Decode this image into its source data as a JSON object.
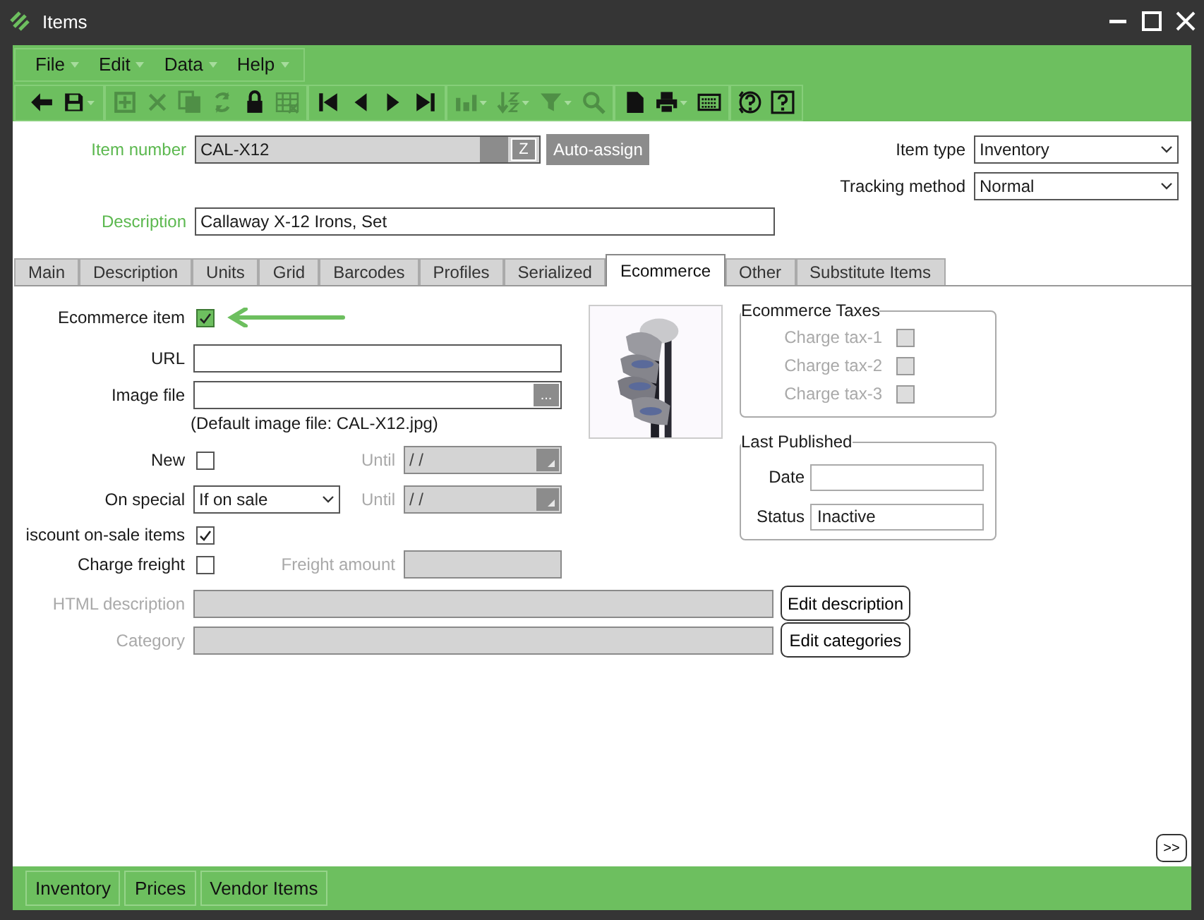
{
  "window": {
    "title": "Items"
  },
  "menu": [
    {
      "label": "File"
    },
    {
      "label": "Edit"
    },
    {
      "label": "Data"
    },
    {
      "label": "Help"
    }
  ],
  "toolbar": {
    "groups": [
      {
        "buttons": [
          {
            "kind": "back",
            "disabled": false,
            "dropdown": false
          },
          {
            "kind": "save",
            "disabled": false,
            "dropdown": true
          }
        ]
      },
      {
        "buttons": [
          {
            "kind": "add",
            "disabled": true,
            "dropdown": false
          },
          {
            "kind": "delete",
            "disabled": true,
            "dropdown": false
          },
          {
            "kind": "copy",
            "disabled": true,
            "dropdown": false
          },
          {
            "kind": "refresh",
            "disabled": true,
            "dropdown": false
          },
          {
            "kind": "lock",
            "disabled": false,
            "dropdown": false
          },
          {
            "kind": "grid",
            "disabled": true,
            "dropdown": false
          }
        ]
      },
      {
        "buttons": [
          {
            "kind": "first",
            "disabled": false,
            "dropdown": false
          },
          {
            "kind": "previous",
            "disabled": false,
            "dropdown": false
          },
          {
            "kind": "next",
            "disabled": false,
            "dropdown": false
          },
          {
            "kind": "last",
            "disabled": false,
            "dropdown": false
          }
        ]
      },
      {
        "buttons": [
          {
            "kind": "chart",
            "disabled": true,
            "dropdown": true
          },
          {
            "kind": "sort",
            "disabled": true,
            "dropdown": true
          },
          {
            "kind": "filter",
            "disabled": true,
            "dropdown": true
          },
          {
            "kind": "search",
            "disabled": true,
            "dropdown": false
          }
        ]
      },
      {
        "buttons": [
          {
            "kind": "document",
            "disabled": false,
            "dropdown": false
          },
          {
            "kind": "print",
            "disabled": false,
            "dropdown": true
          },
          {
            "kind": "keyboard",
            "disabled": false,
            "dropdown": false
          }
        ]
      },
      {
        "buttons": [
          {
            "kind": "help-circle",
            "disabled": false,
            "dropdown": false
          },
          {
            "kind": "help-box",
            "disabled": false,
            "dropdown": false
          }
        ]
      }
    ]
  },
  "header": {
    "item_number": {
      "label": "Item number",
      "value": "CAL-X12",
      "zoom_button": "Z"
    },
    "auto_assign": "Auto-assign",
    "description": {
      "label": "Description",
      "value": "Callaway X-12 Irons, Set"
    },
    "item_type": {
      "label": "Item type",
      "value": "Inventory"
    },
    "tracking_method": {
      "label": "Tracking method",
      "value": "Normal"
    }
  },
  "tabs": [
    {
      "label": "Main",
      "selected": false
    },
    {
      "label": "Description",
      "selected": false
    },
    {
      "label": "Units",
      "selected": false
    },
    {
      "label": "Grid",
      "selected": false
    },
    {
      "label": "Barcodes",
      "selected": false
    },
    {
      "label": "Profiles",
      "selected": false
    },
    {
      "label": "Serialized",
      "selected": false
    },
    {
      "label": "Ecommerce",
      "selected": true
    },
    {
      "label": "Other",
      "selected": false
    },
    {
      "label": "Substitute Items",
      "selected": false
    }
  ],
  "ecommerce": {
    "ecommerce_item": {
      "label": "Ecommerce item",
      "checked": true,
      "focused": true
    },
    "url": {
      "label": "URL"
    },
    "image_file": {
      "label": "Image file",
      "browse_button": "...",
      "note": "(Default image file: CAL-X12.jpg)"
    },
    "new": {
      "label": "New",
      "checked": false,
      "until": {
        "label": "Until",
        "value": "/ /",
        "disabled": true
      }
    },
    "on_special": {
      "label": "On special",
      "value": "If on sale",
      "until": {
        "label": "Until",
        "value": "/ /",
        "disabled": true
      }
    },
    "discount_on_sale": {
      "label": "iscount on-sale items",
      "checked": true
    },
    "charge_freight": {
      "label": "Charge freight",
      "checked": false,
      "freight_amount": {
        "label": "Freight amount",
        "disabled": true
      }
    },
    "html_description": {
      "label": "HTML description",
      "disabled": true,
      "button": "Edit description"
    },
    "category": {
      "label": "Category",
      "disabled": true,
      "button": "Edit categories"
    },
    "ecommerce_taxes": {
      "title": "Ecommerce Taxes",
      "items": [
        {
          "label": "Charge tax-1",
          "checked": false,
          "disabled": true
        },
        {
          "label": "Charge tax-2",
          "checked": false,
          "disabled": true
        },
        {
          "label": "Charge tax-3",
          "checked": false,
          "disabled": true
        }
      ]
    },
    "last_published": {
      "title": "Last Published",
      "date": {
        "label": "Date"
      },
      "status": {
        "label": "Status",
        "value": "Inactive"
      }
    }
  },
  "more_button": ">>",
  "bottom_bar": [
    {
      "label": "Inventory"
    },
    {
      "label": "Prices"
    },
    {
      "label": "Vendor Items"
    }
  ]
}
